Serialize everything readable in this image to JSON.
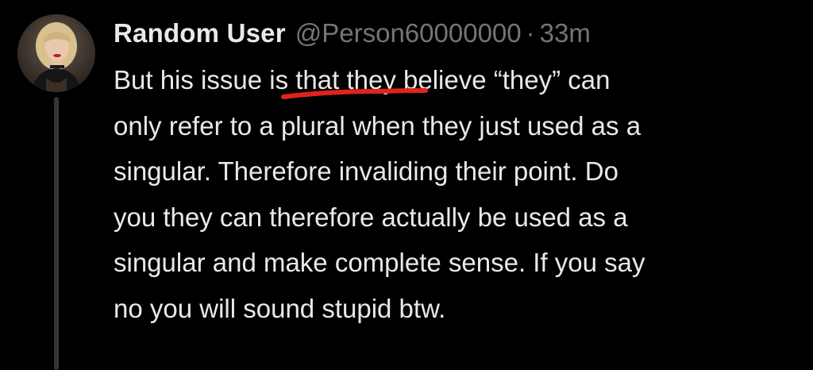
{
  "tweet": {
    "display_name": "Random User",
    "handle": "@Person60000000",
    "separator": "·",
    "time": "33m",
    "body_lines": [
      "But his issue is that they believe “they” can",
      "only refer to a plural when they just used as a",
      "singular. Therefore invaliding their point. Do",
      "you they can therefore actually be used as a",
      "singular and make complete sense. If you say",
      "no you will sound stupid btw."
    ]
  },
  "colors": {
    "background": "#000000",
    "text_primary": "#e7e9ea",
    "text_secondary": "#71767b",
    "thread_line": "#333639",
    "annotation_red": "#e0241b"
  },
  "icons": {
    "avatar": "profile-photo"
  }
}
